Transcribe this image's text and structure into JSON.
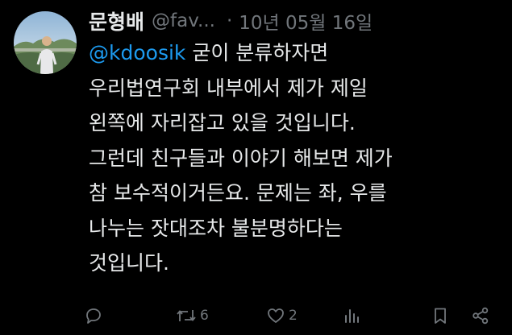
{
  "tweet": {
    "display_name": "문형배",
    "handle": "@fav...",
    "separator": "·",
    "date": "10년 05월 16일",
    "mention": "@kdoosik",
    "line1_rest": " 굳이 분류하자면",
    "lines": [
      "우리법연구회 내부에서 제가 제일",
      "왼쪽에 자리잡고 있을 것입니다.",
      "그런데 친구들과 이야기 해보면 제가",
      "참 보수적이거든요. 문제는 좌, 우를",
      "나누는 잣대조차 불분명하다는",
      "것입니다."
    ]
  },
  "actions": {
    "reply_icon": "reply-icon",
    "retweet_icon": "retweet-icon",
    "retweet_count": "6",
    "like_icon": "heart-icon",
    "like_count": "2",
    "views_icon": "views-icon",
    "bookmark_icon": "bookmark-icon",
    "share_icon": "share-icon"
  },
  "colors": {
    "background": "#000000",
    "text": "#e7e9ea",
    "secondary": "#71767b",
    "link": "#1d9bf0"
  }
}
